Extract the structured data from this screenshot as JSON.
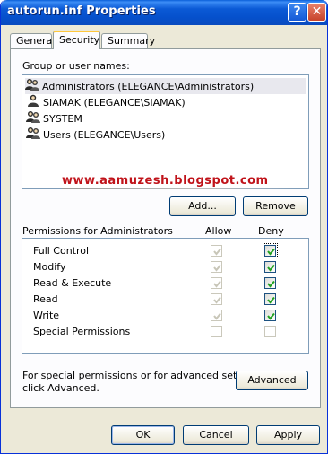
{
  "window": {
    "title": "autorun.inf Properties"
  },
  "tabs": [
    {
      "label": "General",
      "active": false
    },
    {
      "label": "Security",
      "active": true
    },
    {
      "label": "Summary",
      "active": false
    }
  ],
  "groups": {
    "label": "Group or user names:",
    "items": [
      {
        "name": "Administrators (ELEGANCE\\Administrators)",
        "selected": true
      },
      {
        "name": "SIAMAK (ELEGANCE\\SIAMAK)",
        "selected": false
      },
      {
        "name": "SYSTEM",
        "selected": false
      },
      {
        "name": "Users (ELEGANCE\\Users)",
        "selected": false
      }
    ]
  },
  "watermark": "www.aamuzesh.blogspot.com",
  "buttons": {
    "add": "Add...",
    "remove": "Remove",
    "advanced": "Advanced",
    "ok": "OK",
    "cancel": "Cancel",
    "apply": "Apply"
  },
  "permissions": {
    "label": "Permissions for Administrators",
    "allow_header": "Allow",
    "deny_header": "Deny",
    "rows": [
      {
        "name": "Full Control",
        "allow": true,
        "deny": true
      },
      {
        "name": "Modify",
        "allow": true,
        "deny": true
      },
      {
        "name": "Read & Execute",
        "allow": true,
        "deny": true
      },
      {
        "name": "Read",
        "allow": true,
        "deny": true
      },
      {
        "name": "Write",
        "allow": true,
        "deny": true
      },
      {
        "name": "Special Permissions",
        "allow": false,
        "deny": false
      }
    ]
  },
  "advanced_note": {
    "line1": "For special permissions or for advanced settings,",
    "line2": "click Advanced."
  },
  "colors": {
    "titlebar": "#0550cc",
    "face": "#ece9d8",
    "accent_tab": "#ffc83c",
    "check_green": "#21a121",
    "watermark": "#c0131a"
  }
}
